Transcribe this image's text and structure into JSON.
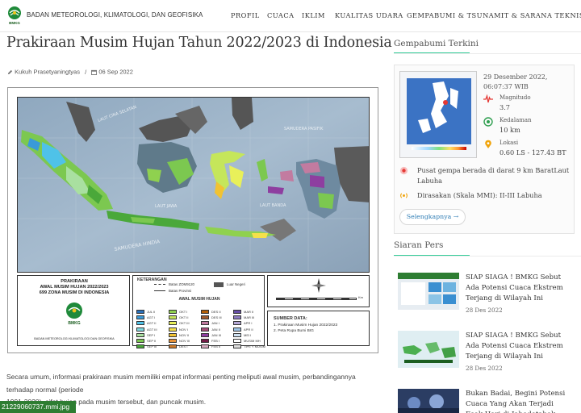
{
  "header": {
    "org_name": "BADAN METEOROLOGI, KLIMATOLOGI, DAN GEOFISIKA",
    "logo_text": "BMKG",
    "nav": [
      "PROFIL",
      "CUACA",
      "IKLIM",
      "KUALITAS UDARA",
      "GEMPABUMI & TSUNAMI",
      "IT & SARANA TEKNIS"
    ]
  },
  "article": {
    "title": "Prakiraan Musim Hujan Tahun 2022/2023 di Indonesia",
    "author": "Kukuh Prasetyaningtyas",
    "separator": "/",
    "date": "06 Sep 2022",
    "body_line1": "Secara umum, informasi prakiraan musim memiliki empat informasi penting meliputi awal musim, perbandingannya",
    "body_line2": "terhadap normal (periode",
    "body_line3": "1991-2020), sifat hujan pada musim tersebut, dan puncak musim."
  },
  "map": {
    "sea_labels": [
      "LAUT CINA SELATAN",
      "SAMUDERA PASIFIK",
      "LAUT JAWA",
      "LAUT BANDA",
      "SAMUDERA HINDIA"
    ],
    "forecast_title_1": "PRAKIRAAN",
    "forecast_title_2": "AWAL MUSIM HUJAN 2022/2023",
    "forecast_title_3": "699 ZONA MUSIM DI INDONESIA",
    "agency": "BADAN METEOROLOGI KLIMATOLOGI DAN GEOFISIKA",
    "keterangan": "KETERANGAN",
    "batas_zom": "Batas ZOM9120",
    "batas_provinsi": "Batas Provinsi",
    "luar_negeri": "Luar Negeri",
    "awal_musim": "AWAL MUSIM HUJAN",
    "legend_cols": [
      [
        "JUL II",
        "AGT I",
        "AGT II",
        "AGT III",
        "SEP I",
        "SEP II",
        "SEP III"
      ],
      [
        "OKT I",
        "OKT II",
        "OKT III",
        "NOV I",
        "NOV II",
        "NOV III",
        "DES I"
      ],
      [
        "DES II",
        "DES III",
        "JAN I",
        "JAN II",
        "JAN III",
        "FEB I",
        "FEB II"
      ],
      [
        "MAR II",
        "MAR III",
        "APR I",
        "APR II",
        "MEI I",
        "MUSIM MH",
        "TIPE Y MUSIM"
      ]
    ],
    "legend_colors": [
      [
        "#2a6fb8",
        "#3a9ad9",
        "#4fc2e8",
        "#7fd9e0",
        "#a9e0a0",
        "#7cc850",
        "#4aa83a"
      ],
      [
        "#8fd14f",
        "#c5e65a",
        "#e8f05a",
        "#f5e04a",
        "#f1c232",
        "#e69138",
        "#cc7a2a"
      ],
      [
        "#b45f06",
        "#a05a2c",
        "#c27ba0",
        "#a64d79",
        "#8e3ea0",
        "#741b47",
        "#d5a6bd"
      ],
      [
        "#674ea7",
        "#8e7cc3",
        "#b4a7d6",
        "#9fc5e8",
        "#cfe2f3",
        "#ffffff",
        "#e0e0e0"
      ]
    ],
    "sumber_data": "SUMBER DATA:",
    "sumber_1": "1. Prakiraan Musim Hujan 2022/2023",
    "sumber_2": "2. Peta Rupa Bumi BIG",
    "scale_label": "Km"
  },
  "sidebar": {
    "gempa_title": "Gempabumi Terkini",
    "gempa_time": "29 Desember 2022, 06:07:37 WIB",
    "magnitudo_label": "Magnitudo",
    "magnitudo_value": "3.7",
    "kedalaman_label": "Kedalaman",
    "kedalaman_value": "10 km",
    "lokasi_label": "Lokasi",
    "lokasi_value": "0.60 LS - 127.43 BT",
    "pusat": "Pusat gempa berada di darat 9 km BaratLaut Labuha",
    "dirasakan": "Dirasakan (Skala MMI): II-III Labuha",
    "more_button": "Selengkapnya →",
    "siaran_title": "Siaran Pers",
    "press": [
      {
        "title": "SIAP SIAGA ! BMKG Sebut Ada Potensi Cuaca Ekstrem Terjang di Wilayah Ini",
        "date": "28 Des 2022"
      },
      {
        "title": "SIAP SIAGA ! BMKG Sebut Ada Potensi Cuaca Ekstrem Terjang di Wilayah Ini",
        "date": "28 Des 2022"
      },
      {
        "title": "Bukan Badai, Begini Potensi Cuaca Yang Akan Terjadi Esok Hari di Jabodetabek Menurut",
        "date": ""
      }
    ]
  },
  "filebar": {
    "name": "21229060737.mmi.jpg"
  }
}
